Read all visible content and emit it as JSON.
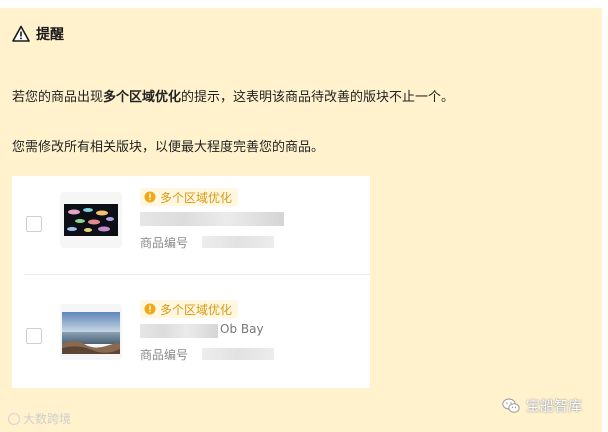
{
  "notice": {
    "title": "提醒",
    "icon": "warning-icon",
    "paragraph1": {
      "before": "若您的商品出现",
      "bold": "多个区域优化",
      "after": "的提示，这表明该商品待改善的版块不止一个。"
    },
    "paragraph2": "您需修改所有相关版块，以便最大程度完善您的商品。"
  },
  "products": [
    {
      "badge": "多个区域优化",
      "sku_label": "商品编号",
      "checked": false,
      "thumb_icon": "aquarium-fish-image"
    },
    {
      "badge": "多个区域优化",
      "title_tail": "Ob Bay",
      "sku_label": "商品编号",
      "checked": false,
      "thumb_icon": "coastal-landscape-image"
    }
  ],
  "watermarks": {
    "left": "大数跨境",
    "right": "宝船智库"
  },
  "colors": {
    "notice_bg": "#fff2cc",
    "badge_text": "#d99a12",
    "badge_bg": "#fff7e0"
  }
}
